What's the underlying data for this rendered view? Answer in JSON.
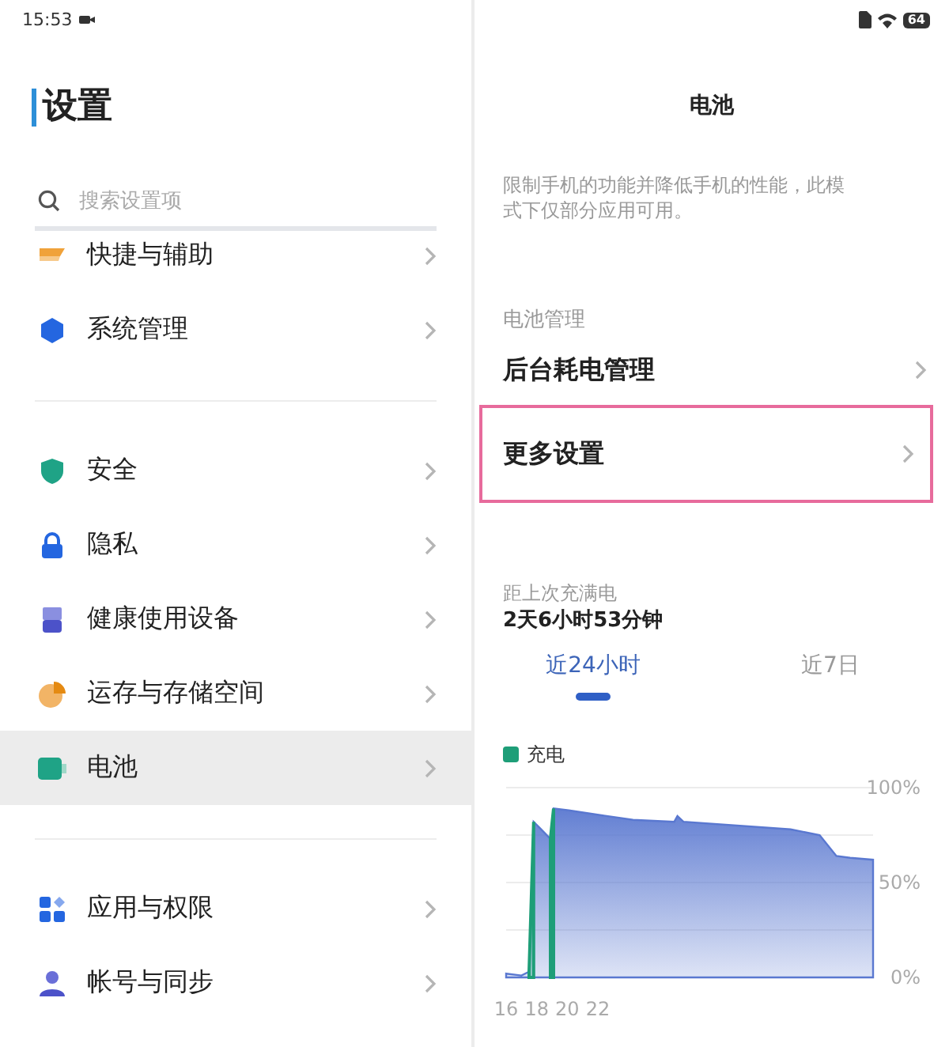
{
  "status_bar": {
    "time": "15:53",
    "battery": "64"
  },
  "sidebar": {
    "title": "设置",
    "search": {
      "placeholder": "搜索设置项"
    },
    "groups": [
      {
        "items": [
          {
            "label": "快捷与辅助",
            "selected": false
          },
          {
            "label": "系统管理",
            "selected": false
          }
        ]
      },
      {
        "items": [
          {
            "label": "安全",
            "selected": false
          },
          {
            "label": "隐私",
            "selected": false
          },
          {
            "label": "健康使用设备",
            "selected": false
          },
          {
            "label": "运存与存储空间",
            "selected": false
          },
          {
            "label": "电池",
            "selected": true
          }
        ]
      },
      {
        "items": [
          {
            "label": "应用与权限",
            "selected": false
          },
          {
            "label": "帐号与同步",
            "selected": false
          }
        ]
      }
    ]
  },
  "detail": {
    "title": "电池",
    "description": "限制手机的功能并降低手机的性能，此模式下仅部分应用可用。",
    "section_label": "电池管理",
    "rows": [
      {
        "label": "后台耗电管理",
        "highlighted": false
      },
      {
        "label": "更多设置",
        "highlighted": true
      }
    ],
    "since_full_charge": {
      "label": "距上次充满电",
      "value": "2天6小时53分钟"
    },
    "tabs": [
      {
        "label": "近24小时",
        "selected": true
      },
      {
        "label": "近7日",
        "selected": false
      }
    ],
    "chart_data": {
      "type": "area",
      "x": [
        16,
        17,
        17.5,
        17.8,
        18.3,
        18.9,
        19.1,
        20.1,
        24.3,
        27,
        27.2,
        27.6,
        34.6,
        36.5,
        37.6,
        38.5,
        40
      ],
      "series": [
        {
          "name": "充电",
          "color": "#1e9e78",
          "values": [
            null,
            null,
            3,
            82,
            null,
            73,
            89,
            null,
            null,
            null,
            null,
            null,
            null,
            null,
            null,
            null,
            null
          ]
        },
        {
          "color": "#5a78d0",
          "values": [
            2,
            1,
            3,
            82,
            78,
            73,
            89,
            88,
            83,
            82,
            85,
            82,
            78,
            75,
            64,
            63,
            62
          ]
        }
      ],
      "xlim": [
        16,
        40
      ],
      "ylim": [
        0,
        100
      ],
      "xticks": [
        16,
        18,
        20,
        22
      ],
      "yticks": [
        {
          "value": 0,
          "label": "0%"
        },
        {
          "value": 50,
          "label": "50%"
        },
        {
          "value": 100,
          "label": "100%"
        }
      ]
    }
  }
}
